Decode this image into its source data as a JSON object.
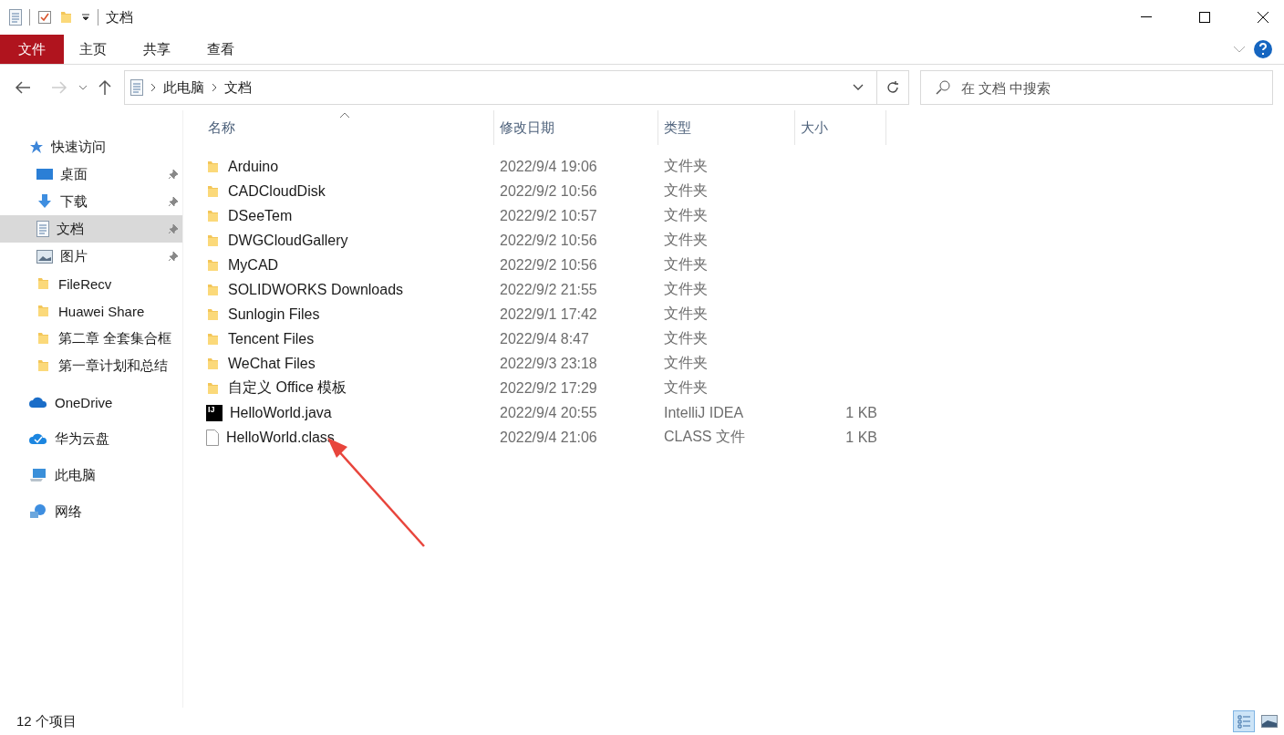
{
  "window": {
    "title": "文档"
  },
  "ribbon": {
    "tabs": [
      {
        "label": "文件",
        "kind": "file"
      },
      {
        "label": "主页",
        "kind": "tab"
      },
      {
        "label": "共享",
        "kind": "tab"
      },
      {
        "label": "查看",
        "kind": "tab"
      }
    ]
  },
  "address": {
    "path": [
      "此电脑",
      "文档"
    ],
    "search_placeholder": "在 文档 中搜索"
  },
  "sidebar": {
    "items": [
      {
        "label": "快速访问",
        "kind": "star",
        "selected": false,
        "children": [
          {
            "label": "桌面",
            "kind": "desktop",
            "pinned": true,
            "selected": false
          },
          {
            "label": "下载",
            "kind": "download",
            "pinned": true,
            "selected": false
          },
          {
            "label": "文档",
            "kind": "document",
            "pinned": true,
            "selected": true
          },
          {
            "label": "图片",
            "kind": "picture",
            "pinned": true,
            "selected": false
          },
          {
            "label": "FileRecv",
            "kind": "folder",
            "pinned": false,
            "selected": false
          },
          {
            "label": "Huawei Share",
            "kind": "folder",
            "pinned": false,
            "selected": false
          },
          {
            "label": "第二章 全套集合框",
            "kind": "folder",
            "pinned": false,
            "selected": false
          },
          {
            "label": "第一章计划和总结",
            "kind": "folder",
            "pinned": false,
            "selected": false
          }
        ]
      },
      {
        "label": "OneDrive",
        "kind": "cloud",
        "selected": false
      },
      {
        "label": "华为云盘",
        "kind": "cloud-check",
        "selected": false
      },
      {
        "label": "此电脑",
        "kind": "computer",
        "selected": false
      },
      {
        "label": "网络",
        "kind": "network",
        "selected": false
      }
    ]
  },
  "table": {
    "columns": [
      {
        "label": "名称",
        "sorted": true
      },
      {
        "label": "修改日期",
        "sorted": false
      },
      {
        "label": "类型",
        "sorted": false
      },
      {
        "label": "大小",
        "sorted": false
      }
    ],
    "rows": [
      {
        "kind": "folder",
        "name": "Arduino",
        "date": "2022/9/4 19:06",
        "type": "文件夹"
      },
      {
        "kind": "folder",
        "name": "CADCloudDisk",
        "date": "2022/9/2 10:56",
        "type": "文件夹"
      },
      {
        "kind": "folder",
        "name": "DSeeTem",
        "date": "2022/9/2 10:57",
        "type": "文件夹"
      },
      {
        "kind": "folder",
        "name": "DWGCloudGallery",
        "date": "2022/9/2 10:56",
        "type": "文件夹"
      },
      {
        "kind": "folder",
        "name": "MyCAD",
        "date": "2022/9/2 10:56",
        "type": "文件夹"
      },
      {
        "kind": "folder",
        "name": "SOLIDWORKS Downloads",
        "date": "2022/9/2 21:55",
        "type": "文件夹"
      },
      {
        "kind": "folder",
        "name": "Sunlogin Files",
        "date": "2022/9/1 17:42",
        "type": "文件夹"
      },
      {
        "kind": "folder",
        "name": "Tencent Files",
        "date": "2022/9/4 8:47",
        "type": "文件夹"
      },
      {
        "kind": "folder",
        "name": "WeChat Files",
        "date": "2022/9/3 23:18",
        "type": "文件夹"
      },
      {
        "kind": "folder",
        "name": "自定义 Office 模板",
        "date": "2022/9/2 17:29",
        "type": "文件夹"
      },
      {
        "kind": "ij",
        "ij_text": "IJ",
        "name": "HelloWorld.java",
        "date": "2022/9/4 20:55",
        "type": "IntelliJ IDEA",
        "size": "1 KB"
      },
      {
        "kind": "file",
        "name": "HelloWorld.class",
        "date": "2022/9/4 21:06",
        "type": "CLASS 文件",
        "size": "1 KB"
      }
    ]
  },
  "status_bar": {
    "count": "12 个项目",
    "views": [
      {
        "kind": "details",
        "selected": true
      },
      {
        "kind": "thumbnails",
        "selected": false
      }
    ]
  }
}
